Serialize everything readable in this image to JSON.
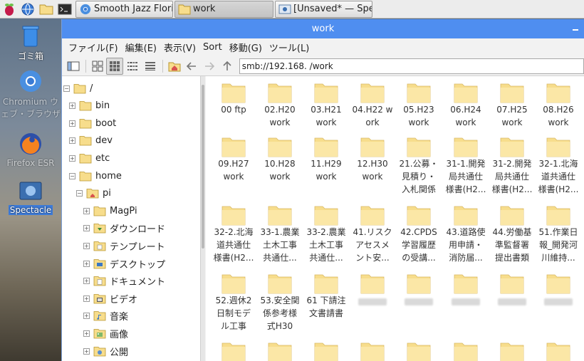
{
  "taskbar": {
    "tasks": [
      {
        "label": "Smooth Jazz Flori"
      },
      {
        "label": "work"
      },
      {
        "label": "[Unsaved* — Spe"
      }
    ]
  },
  "desktop": {
    "items": [
      {
        "label": "ゴミ箱"
      },
      {
        "label": "Chromium ウェブ・ブラウザ"
      },
      {
        "label": "Firefox ESR"
      },
      {
        "label": "Spectacle"
      }
    ]
  },
  "window": {
    "title": "work",
    "menu": [
      "ファイル(F)",
      "編集(E)",
      "表示(V)",
      "Sort",
      "移動(G)",
      "ツール(L)"
    ],
    "address": "smb://192.168.     /work"
  },
  "tree": [
    {
      "label": "/",
      "sign": "⊟",
      "icon": "folder"
    },
    {
      "label": "bin",
      "sign": "⊞",
      "icon": "folder"
    },
    {
      "label": "boot",
      "sign": "⊞",
      "icon": "folder"
    },
    {
      "label": "dev",
      "sign": "⊞",
      "icon": "folder"
    },
    {
      "label": "etc",
      "sign": "⊞",
      "icon": "folder"
    },
    {
      "label": "home",
      "sign": "⊟",
      "icon": "folder"
    },
    {
      "label": "pi",
      "sign": "⊟",
      "icon": "home-folder"
    },
    {
      "label": "MagPi",
      "sign": "⊞",
      "icon": "folder"
    },
    {
      "label": "ダウンロード",
      "sign": "⊞",
      "icon": "download-folder"
    },
    {
      "label": "テンプレート",
      "sign": "⊞",
      "icon": "template-folder"
    },
    {
      "label": "デスクトップ",
      "sign": "⊞",
      "icon": "desktop-folder"
    },
    {
      "label": "ドキュメント",
      "sign": "⊞",
      "icon": "document-folder"
    },
    {
      "label": "ビデオ",
      "sign": "⊞",
      "icon": "video-folder"
    },
    {
      "label": "音楽",
      "sign": "⊞",
      "icon": "music-folder"
    },
    {
      "label": "画像",
      "sign": "⊞",
      "icon": "picture-folder"
    },
    {
      "label": "公開",
      "sign": "⊞",
      "icon": "public-folder"
    }
  ],
  "files": [
    [
      "00 ftp"
    ],
    [
      "02.H20",
      "work"
    ],
    [
      "03.H21",
      "work"
    ],
    [
      "04.H22 w",
      "ork"
    ],
    [
      "05.H23",
      "work"
    ],
    [
      "06.H24",
      "work"
    ],
    [
      "07.H25",
      "work"
    ],
    [
      "08.H26",
      "work"
    ],
    [
      "09.H27",
      "work"
    ],
    [
      "10.H28",
      "work"
    ],
    [
      "11.H29",
      "work"
    ],
    [
      "12.H30",
      "work"
    ],
    [
      "21.公募・",
      "見積り・",
      "入札関係"
    ],
    [
      "31-1.開発",
      "局共通仕",
      "様書(H2..."
    ],
    [
      "31-2.開発",
      "局共通仕",
      "様書(H2..."
    ],
    [
      "32-1.北海",
      "道共通仕",
      "様書(H2..."
    ],
    [
      "32-2.北海",
      "道共通仕",
      "様書(H2..."
    ],
    [
      "33-1.農業",
      "土木工事",
      "共通仕..."
    ],
    [
      "33-2.農業",
      "土木工事",
      "共通仕..."
    ],
    [
      "41.リスク",
      "アセスメ",
      "ント安..."
    ],
    [
      "42.CPDS",
      "学習履歴",
      "の受講..."
    ],
    [
      "43.道路使",
      "用申請・",
      "消防届..."
    ],
    [
      "44.労働基",
      "準監督署",
      "提出書類"
    ],
    [
      "51.作業日",
      "報_開発河",
      "川維持..."
    ],
    [
      "52.週休2",
      "日制モデ",
      "ル工事"
    ],
    [
      "53.安全関",
      "係参考様",
      "式H30"
    ],
    [
      "61 下請注",
      "文書請書"
    ],
    [],
    [],
    [],
    [],
    [],
    [],
    [],
    [],
    [],
    [],
    [],
    [],
    []
  ],
  "colors": {
    "accent": "#4f8ef0",
    "folder": "#f7dd8c",
    "folder_tab": "#e8c66a"
  }
}
